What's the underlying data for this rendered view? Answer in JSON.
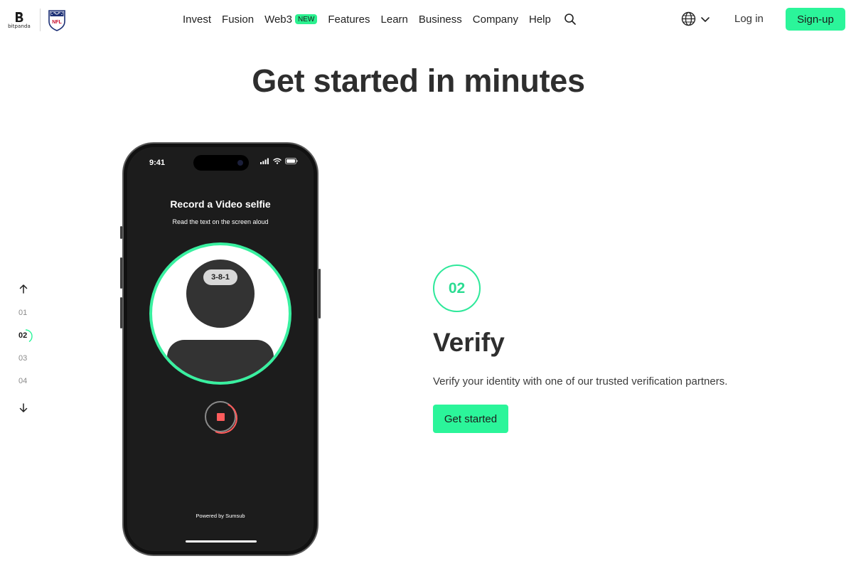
{
  "header": {
    "logo_text": "bitpanda",
    "partner_logo_text": "NFL",
    "nav": [
      {
        "label": "Invest"
      },
      {
        "label": "Fusion"
      },
      {
        "label": "Web3",
        "badge": "NEW"
      },
      {
        "label": "Features"
      },
      {
        "label": "Learn"
      },
      {
        "label": "Business"
      },
      {
        "label": "Company"
      },
      {
        "label": "Help"
      }
    ],
    "icons": {
      "search": "search-icon",
      "language": "globe-icon",
      "language_dropdown": "chevron-down-icon"
    },
    "login_label": "Log in",
    "signup_label": "Sign-up"
  },
  "page": {
    "title": "Get started in minutes"
  },
  "step_nav": {
    "steps": [
      "01",
      "02",
      "03",
      "04"
    ],
    "active": "02",
    "icons": {
      "prev": "arrow-up-icon",
      "next": "arrow-down-icon"
    }
  },
  "phone": {
    "status_time": "9:41",
    "screen_title": "Record a Video selfie",
    "screen_subtitle": "Read the text on the screen aloud",
    "code": "3-8-1",
    "powered_by": "Powered by",
    "provider": "Sumsub"
  },
  "step": {
    "number": "02",
    "title": "Verify",
    "description": "Verify your identity with one of our trusted verification partners.",
    "cta_label": "Get started"
  },
  "colors": {
    "accent": "#2bf59a",
    "accent_text": "#2bdc92",
    "record": "#ff5c5c",
    "phone_bg": "#1c1c1c"
  }
}
